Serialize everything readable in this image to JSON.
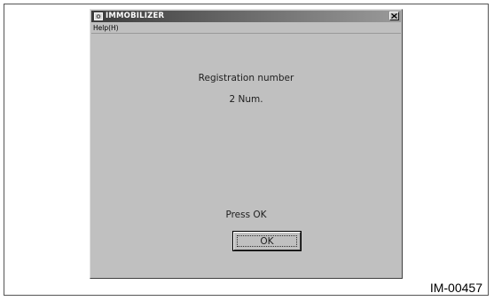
{
  "window": {
    "title": "IMMOBILIZER",
    "close_icon": "close-icon",
    "app_icon": "immobilizer-app-icon"
  },
  "menu": {
    "help_label": "Help(H)"
  },
  "content": {
    "registration_label": "Registration number",
    "registration_value": "2 Num.",
    "prompt": "Press OK",
    "ok_label": "OK"
  },
  "figure_id": "IM-00457"
}
